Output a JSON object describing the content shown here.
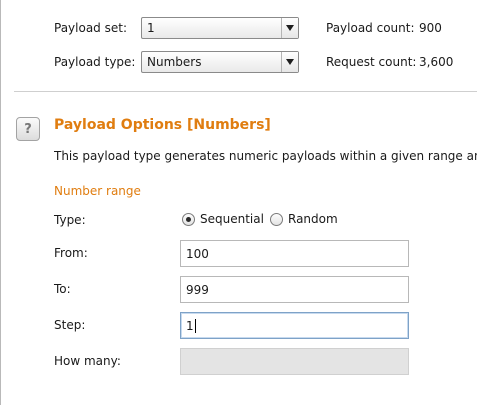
{
  "payload_settings": {
    "payload_set_label": "Payload set:",
    "payload_set_value": "1",
    "payload_type_label": "Payload type:",
    "payload_type_value": "Numbers",
    "payload_count_label": "Payload count:",
    "payload_count_value": "900",
    "request_count_label": "Request count:",
    "request_count_value": "3,600"
  },
  "options": {
    "help_glyph": "?",
    "title": "Payload Options [Numbers]",
    "description": "This payload type generates numeric payloads within a given range and in",
    "number_range_heading": "Number range",
    "type_label": "Type:",
    "type_options": [
      {
        "label": "Sequential",
        "selected": true
      },
      {
        "label": "Random",
        "selected": false
      }
    ],
    "from_label": "From:",
    "from_value": "100",
    "to_label": "To:",
    "to_value": "999",
    "step_label": "Step:",
    "step_value": "1",
    "how_many_label": "How many:",
    "how_many_value": ""
  },
  "colors": {
    "accent": "#e07d10",
    "focus_border": "#7ea2c7"
  },
  "icons": {
    "dropdown": "chevron-down-icon",
    "help": "help-icon"
  }
}
